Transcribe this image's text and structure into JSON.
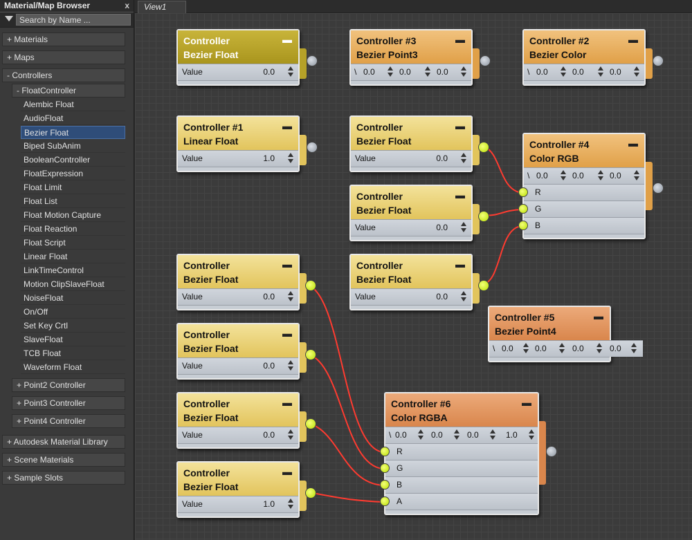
{
  "browser": {
    "title": "Material/Map Browser",
    "close": "x",
    "search_placeholder": "Search by Name ...",
    "categories": {
      "materials": "+ Materials",
      "maps": "+ Maps",
      "controllers": "- Controllers",
      "float_controller": "- FloatController",
      "point2": "+ Point2 Controller",
      "point3": "+ Point3 Controller",
      "point4": "+ Point4 Controller",
      "autodesk": "+ Autodesk Material Library",
      "scene": "+ Scene Materials",
      "samples": "+ Sample Slots"
    },
    "float_items": [
      "Alembic Float",
      "AudioFloat",
      "Bezier Float",
      "Biped SubAnim",
      "BooleanController",
      "FloatExpression",
      "Float Limit",
      "Float List",
      "Float Motion Capture",
      "Float Reaction",
      "Float Script",
      "Linear Float",
      "LinkTimeControl",
      "Motion ClipSlaveFloat",
      "NoiseFloat",
      "On/Off",
      "Set Key Crtl",
      "SlaveFloat",
      "TCB Float",
      "Waveform Float"
    ],
    "selected_item": "Bezier Float"
  },
  "view": {
    "tab_label": "View1"
  },
  "nodes": {
    "bezier_float_top": {
      "title1": "Controller",
      "title2": "Bezier Float",
      "label": "Value",
      "value": "0.0"
    },
    "ctrl3": {
      "title1": "Controller #3",
      "title2": "Bezier Point3",
      "v": [
        "0.0",
        "0.0",
        "0.0"
      ]
    },
    "ctrl2": {
      "title1": "Controller #2",
      "title2": "Bezier Color",
      "v": [
        "0.0",
        "0.0",
        "0.0"
      ]
    },
    "ctrl1": {
      "title1": "Controller #1",
      "title2": "Linear Float",
      "label": "Value",
      "value": "1.0"
    },
    "bf_r": {
      "title1": "Controller",
      "title2": "Bezier Float",
      "label": "Value",
      "value": "0.0"
    },
    "bf_g": {
      "title1": "Controller",
      "title2": "Bezier Float",
      "label": "Value",
      "value": "0.0"
    },
    "bf_b": {
      "title1": "Controller",
      "title2": "Bezier Float",
      "label": "Value",
      "value": "0.0"
    },
    "ctrl4": {
      "title1": "Controller #4",
      "title2": "Color RGB",
      "v": [
        "0.0",
        "0.0",
        "0.0"
      ],
      "inputs": [
        "R",
        "G",
        "B"
      ]
    },
    "ctrl5": {
      "title1": "Controller #5",
      "title2": "Bezier Point4",
      "v": [
        "0.0",
        "0.0",
        "0.0",
        "0.0"
      ]
    },
    "bf_1": {
      "title1": "Controller",
      "title2": "Bezier Float",
      "label": "Value",
      "value": "0.0"
    },
    "bf_2": {
      "title1": "Controller",
      "title2": "Bezier Float",
      "label": "Value",
      "value": "0.0"
    },
    "bf_3": {
      "title1": "Controller",
      "title2": "Bezier Float",
      "label": "Value",
      "value": "0.0"
    },
    "bf_4": {
      "title1": "Controller",
      "title2": "Bezier Float",
      "label": "Value",
      "value": "1.0"
    },
    "ctrl6": {
      "title1": "Controller #6",
      "title2": "Color RGBA",
      "v": [
        "0.0",
        "0.0",
        "0.0",
        "1.0"
      ],
      "inputs": [
        "R",
        "G",
        "B",
        "A"
      ]
    }
  },
  "icons": {
    "minimize": "minimize-icon",
    "spinner": "spinner-icon",
    "collapse": "triangle-down-icon"
  },
  "colors": {
    "wire": "#ff3b30",
    "port_connected": "#d4f21a",
    "port_free": "#a7aeb7",
    "selection": "#2f4d79"
  }
}
